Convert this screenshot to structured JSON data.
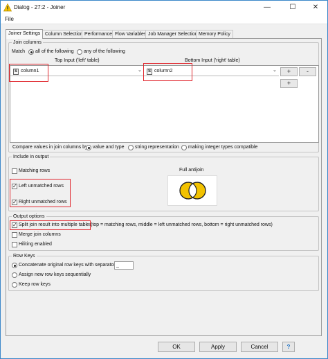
{
  "window": {
    "title": "Dialog - 27:2 - Joiner",
    "minimize_glyph": "—",
    "maximize_glyph": "☐",
    "close_glyph": "✕"
  },
  "menu": {
    "file": "File"
  },
  "tabs": [
    "Joiner Settings",
    "Column Selection",
    "Performance",
    "Flow Variables",
    "Job Manager Selection",
    "Memory Policy"
  ],
  "join_columns": {
    "legend": "Join columns",
    "match_label": "Match",
    "match_all": "all of the following",
    "match_any": "any of the following",
    "match_selected": "all",
    "top_header": "Top Input ('left' table)",
    "bottom_header": "Bottom Input ('right' table)",
    "left_type": "S",
    "left_column": "column1",
    "right_type": "S",
    "right_column": "column2",
    "add_button": "+",
    "remove_button": "-",
    "add_button2": "+",
    "compare_label": "Compare values in join columns by",
    "compare_options": [
      "value and type",
      "string representation",
      "making integer types compatible"
    ],
    "compare_selected": 0
  },
  "include": {
    "legend": "Include in output",
    "matching_rows": "Matching rows",
    "left_unmatched": "Left unmatched rows",
    "right_unmatched": "Right unmatched rows",
    "matching_checked": false,
    "left_checked": true,
    "right_checked": true,
    "venn_title": "Full antijoin",
    "venn_fill": "#f2c200"
  },
  "output": {
    "legend": "Output options",
    "split_label": "Split join result into multiple tables",
    "split_desc": "(top = matching rows, middle = left unmatched rows, bottom = right unmatched rows)",
    "merge_label": "Merge join columns",
    "hilite_label": "Hiliting enabled",
    "split_checked": true
  },
  "rowkeys": {
    "legend": "Row Keys",
    "concat_label": "Concatenate original row keys with separator",
    "separator": "_",
    "assign_label": "Assign new row keys sequentially",
    "keep_label": "Keep row keys",
    "selected": 0
  },
  "footer": {
    "ok": "OK",
    "apply": "Apply",
    "cancel": "Cancel",
    "help": "?"
  },
  "colors": {
    "highlight_box": "#e0262d",
    "accent": "#3a87c9"
  }
}
